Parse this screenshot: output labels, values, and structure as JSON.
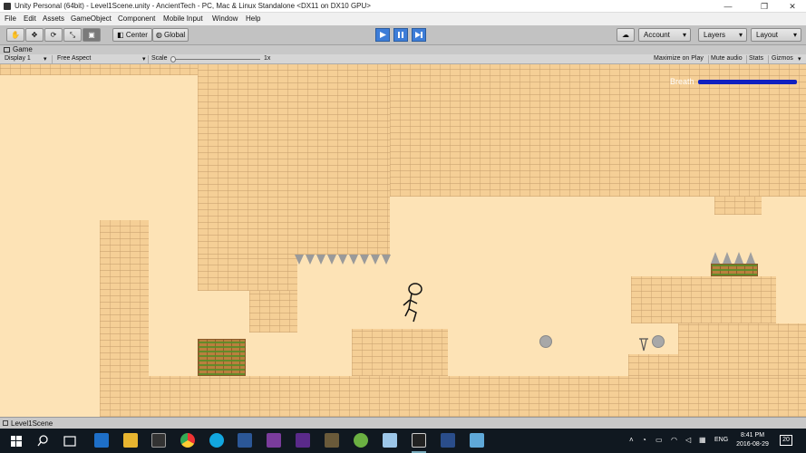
{
  "window": {
    "title": "Unity Personal (64bit) - Level1Scene.unity - AncientTech - PC, Mac & Linux Standalone <DX11 on DX10 GPU>",
    "minimize": "—",
    "maximize": "❐",
    "close": "✕"
  },
  "menu": [
    "File",
    "Edit",
    "Assets",
    "GameObject",
    "Component",
    "Mobile Input",
    "Window",
    "Help"
  ],
  "toolbar": {
    "pivot_label": "Center",
    "space_label": "Global",
    "account_label": "Account",
    "layers_label": "Layers",
    "layout_label": "Layout",
    "dropdown_arrow": "▾"
  },
  "game_panel": {
    "tab_label": "Game",
    "display": "Display 1",
    "aspect": "Free Aspect",
    "scale_label": "Scale",
    "scale_value": "1x",
    "maximize_on_play": "Maximize on Play",
    "mute_audio": "Mute audio",
    "stats": "Stats",
    "gizmos": "Gizmos"
  },
  "game_hud": {
    "breath_label": "Breath",
    "breath_level": 1.0,
    "breath_color": "#1020c0"
  },
  "statusbar": {
    "scene": "Level1Scene"
  },
  "taskbar": {
    "time": "8:41 PM",
    "date": "2016-08-29",
    "language": "ENG",
    "notifications": "20",
    "icons": [
      "windows-icon",
      "search-icon",
      "task-view-icon",
      "edge-icon",
      "file-explorer-icon",
      "store-icon",
      "chrome-icon",
      "skype-icon",
      "word-icon",
      "onenote-icon",
      "app-icon",
      "app-icon-2",
      "android-studio-icon",
      "notepad-icon",
      "unity-icon",
      "powershell-icon",
      "app-icon-3"
    ]
  },
  "colors": {
    "sand": "#fde3b6",
    "brick": "#f5cf96",
    "play_blue": "#3d7dd8"
  }
}
